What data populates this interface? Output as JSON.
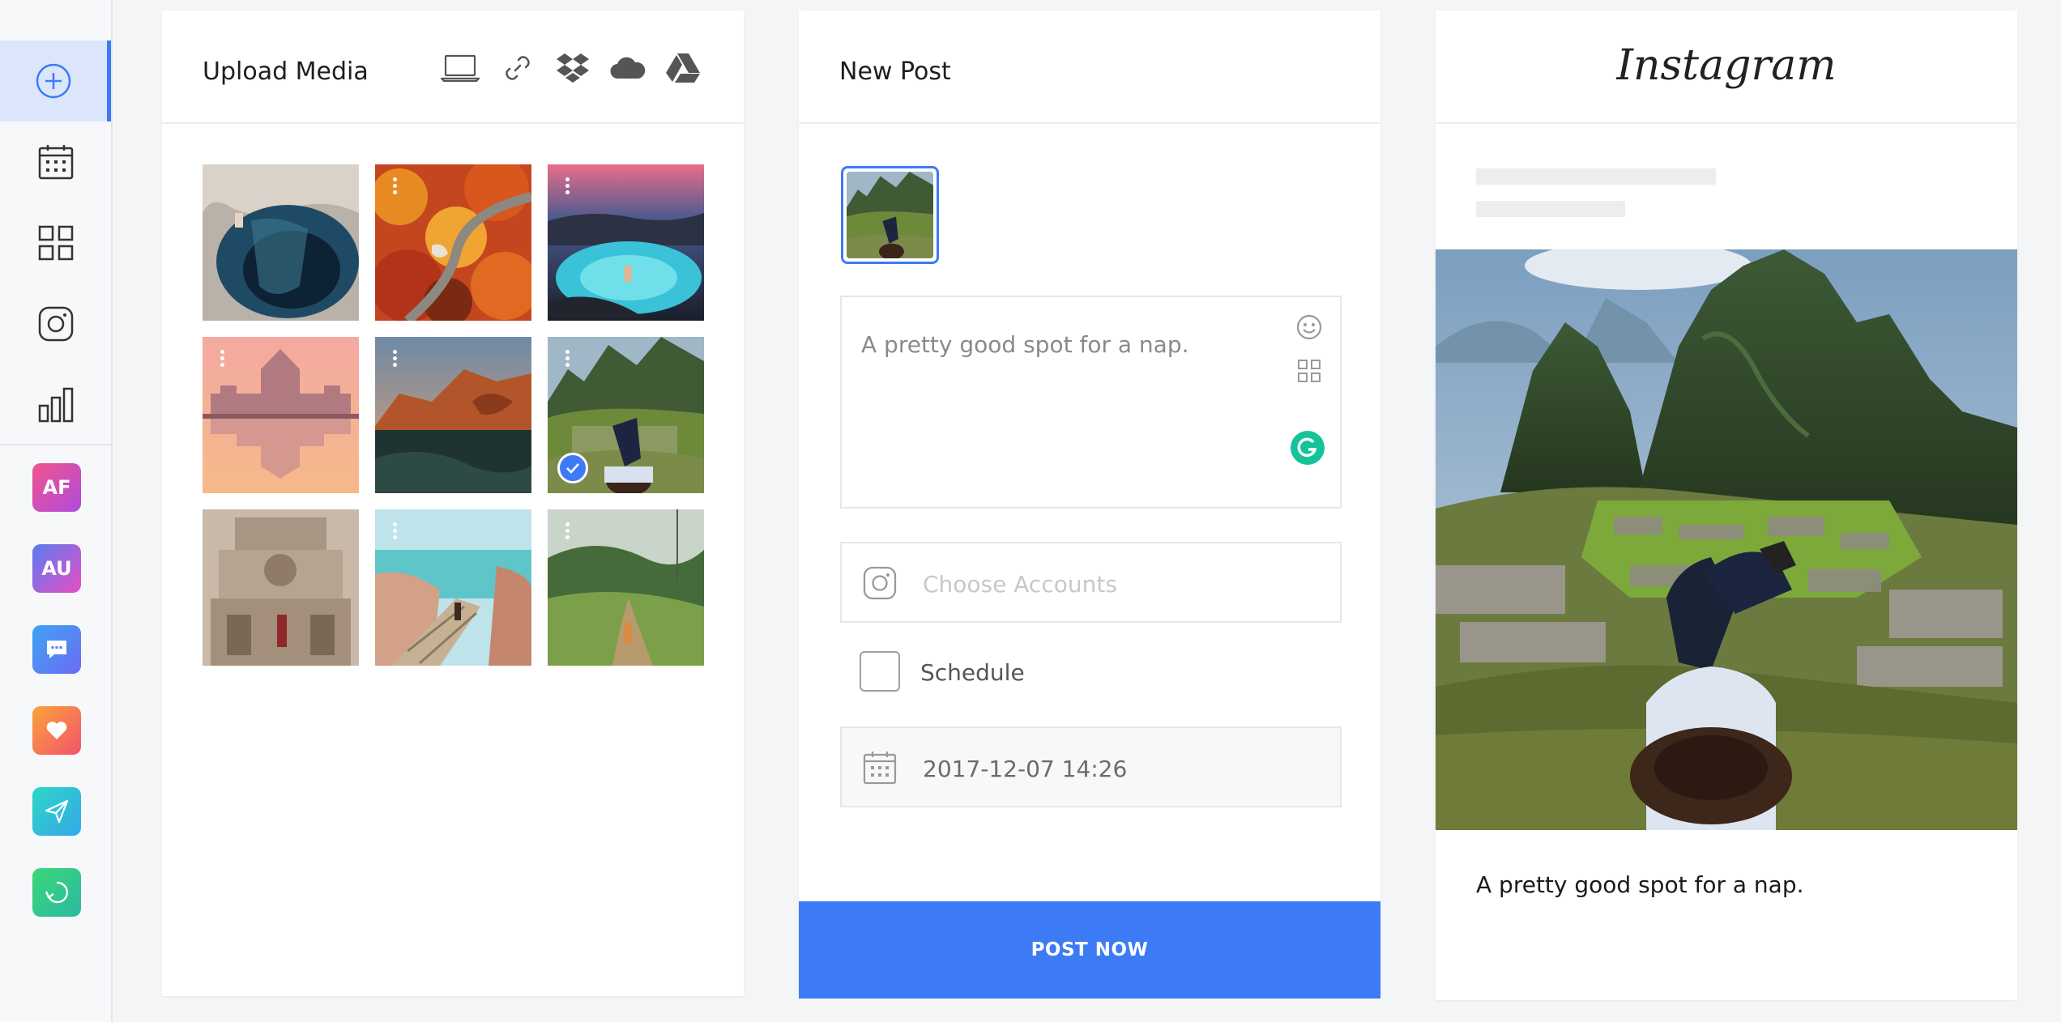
{
  "sidebar": {
    "items": [
      {
        "name": "add",
        "icon": "plus-circle-icon",
        "active": true
      },
      {
        "name": "calendar",
        "icon": "calendar-icon"
      },
      {
        "name": "grid",
        "icon": "grid-icon"
      },
      {
        "name": "instagram",
        "icon": "instagram-icon"
      },
      {
        "name": "analytics",
        "icon": "bar-chart-icon"
      }
    ],
    "apps": [
      {
        "label": "AF",
        "colors": [
          "#f0548a",
          "#b04be0"
        ]
      },
      {
        "label": "AU",
        "colors": [
          "#5a7cf0",
          "#e84ec6"
        ]
      },
      {
        "label": "",
        "icon": "chat-icon",
        "colors": [
          "#3fa3f5",
          "#6b6cf2"
        ]
      },
      {
        "label": "",
        "icon": "heart-icon",
        "colors": [
          "#f9a33a",
          "#f5536d"
        ]
      },
      {
        "label": "",
        "icon": "paper-plane-icon",
        "colors": [
          "#2ed6c7",
          "#34a8e8"
        ]
      },
      {
        "label": "",
        "icon": "refresh-icon",
        "colors": [
          "#3bd877",
          "#2cb8a2"
        ]
      }
    ]
  },
  "upload": {
    "title": "Upload Media",
    "sources": [
      "laptop-icon",
      "link-icon",
      "dropbox-icon",
      "cloud-icon",
      "google-drive-icon"
    ],
    "photos": [
      {
        "name": "cenote",
        "selected": false
      },
      {
        "name": "autumn-road",
        "selected": false
      },
      {
        "name": "blue-lagoon",
        "selected": false
      },
      {
        "name": "parliament",
        "selected": false
      },
      {
        "name": "rock-arch",
        "selected": false
      },
      {
        "name": "machu-picchu",
        "selected": true
      },
      {
        "name": "temple",
        "selected": false
      },
      {
        "name": "boardwalk",
        "selected": false
      },
      {
        "name": "hill-path",
        "selected": false
      }
    ]
  },
  "post": {
    "title": "New Post",
    "caption": "A pretty good spot for a nap.",
    "accounts_placeholder": "Choose Accounts",
    "schedule_label": "Schedule",
    "schedule_checked": false,
    "date": "2017-12-07 14:26",
    "post_button": "POST NOW"
  },
  "preview": {
    "logo": "Instagram",
    "caption": "A pretty good spot for a nap."
  },
  "colors": {
    "accent": "#3d7af5",
    "grammarly": "#15c39a"
  }
}
